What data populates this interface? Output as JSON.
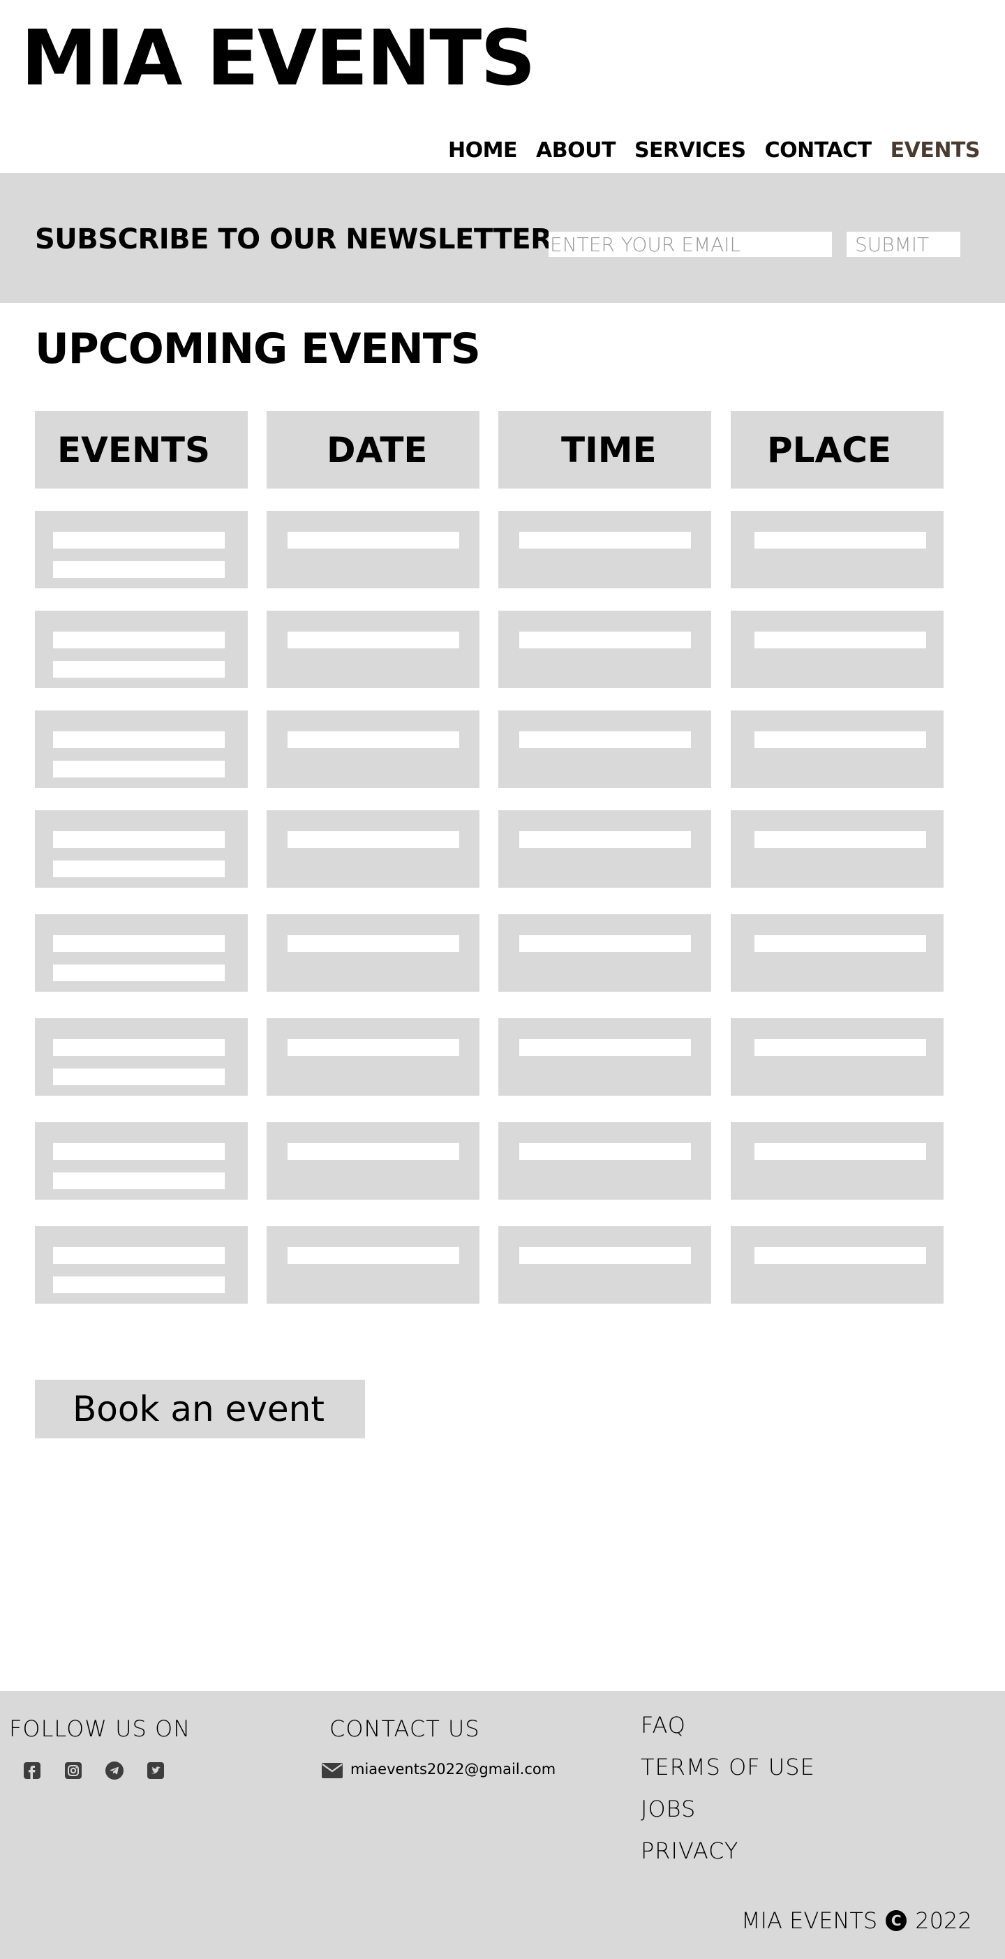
{
  "header": {
    "logo": "MIA EVENTS",
    "nav": [
      {
        "label": "HOME"
      },
      {
        "label": "ABOUT"
      },
      {
        "label": "SERVICES"
      },
      {
        "label": "CONTACT"
      },
      {
        "label": "EVENTS",
        "active": true
      }
    ]
  },
  "newsletter": {
    "title": "SUBSCRIBE TO OUR NEWSLETTER",
    "email_placeholder": "ENTER YOUR EMAIL",
    "submit_label": "SUBMIT"
  },
  "events": {
    "title": "UPCOMING EVENTS",
    "columns": [
      "EVENTS",
      "DATE",
      "TIME",
      "PLACE"
    ],
    "row_count": 8
  },
  "book_button": "Book an event",
  "footer": {
    "follow_title": "FOLLOW US ON",
    "social_icons": [
      "facebook-icon",
      "instagram-icon",
      "telegram-icon",
      "twitter-icon"
    ],
    "contact_title": "CONTACT US",
    "email": "miaevents2022@gmail.com",
    "links": [
      "FAQ",
      "TERMS OF USE",
      "JOBS",
      "PRIVACY"
    ],
    "copyright_brand": "MIA EVENTS",
    "copyright_year": "2022"
  },
  "colors": {
    "panel_gray": "#d9d9d9",
    "active_nav": "#4a3b30",
    "text": "#000000"
  }
}
